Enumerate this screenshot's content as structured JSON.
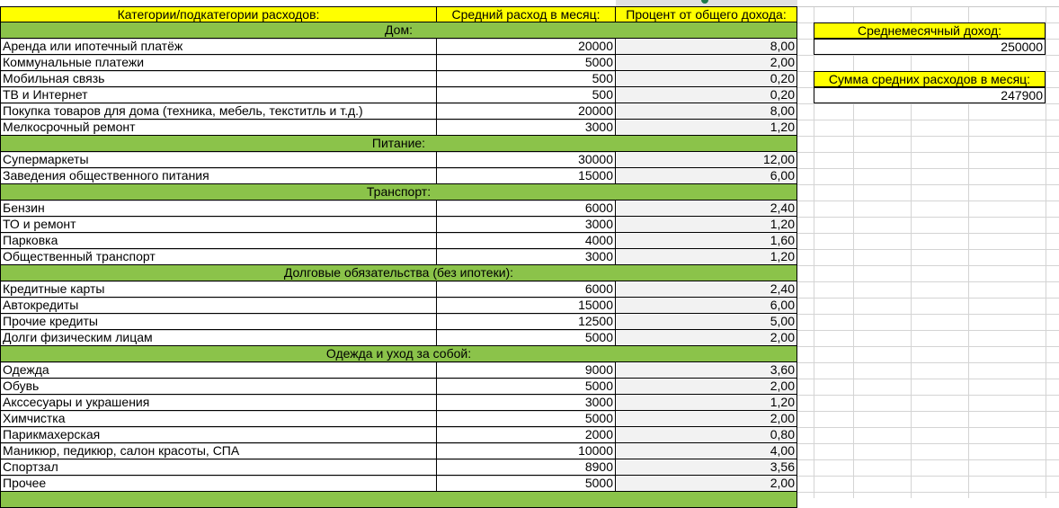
{
  "header": {
    "col1": "Категории/подкатегории расходов:",
    "col2": "Средний расход в месяц:",
    "col3": "Процент от общего дохода:"
  },
  "sections": [
    {
      "title": "Дом:",
      "items": [
        {
          "name": "Аренда или ипотечный платёж",
          "amount": "20000",
          "percent": "8,00"
        },
        {
          "name": "Коммунальные платежи",
          "amount": "5000",
          "percent": "2,00"
        },
        {
          "name": "Мобильная связь",
          "amount": "500",
          "percent": "0,20"
        },
        {
          "name": "ТВ и Интернет",
          "amount": "500",
          "percent": "0,20"
        },
        {
          "name": "Покупка товаров для дома (техника, мебель, текститль и т.д.)",
          "amount": "20000",
          "percent": "8,00"
        },
        {
          "name": "Мелкосрочный ремонт",
          "amount": "3000",
          "percent": "1,20"
        }
      ]
    },
    {
      "title": "Питание:",
      "items": [
        {
          "name": "Супермаркеты",
          "amount": "30000",
          "percent": "12,00"
        },
        {
          "name": "Заведения общественного питания",
          "amount": "15000",
          "percent": "6,00"
        }
      ]
    },
    {
      "title": "Транспорт:",
      "items": [
        {
          "name": "Бензин",
          "amount": "6000",
          "percent": "2,40"
        },
        {
          "name": "ТО и ремонт",
          "amount": "3000",
          "percent": "1,20"
        },
        {
          "name": "Парковка",
          "amount": "4000",
          "percent": "1,60"
        },
        {
          "name": "Общественный транспорт",
          "amount": "3000",
          "percent": "1,20"
        }
      ]
    },
    {
      "title": "Долговые обязательства (без ипотеки):",
      "items": [
        {
          "name": "Кредитные карты",
          "amount": "6000",
          "percent": "2,40"
        },
        {
          "name": "Автокредиты",
          "amount": "15000",
          "percent": "6,00"
        },
        {
          "name": "Прочие кредиты",
          "amount": "12500",
          "percent": "5,00"
        },
        {
          "name": "Долги физическим лицам",
          "amount": "5000",
          "percent": "2,00"
        }
      ]
    },
    {
      "title": "Одежда и уход за собой:",
      "items": [
        {
          "name": "Одежда",
          "amount": "9000",
          "percent": "3,60"
        },
        {
          "name": "Обувь",
          "amount": "5000",
          "percent": "2,00"
        },
        {
          "name": "Акссесуары и украшения",
          "amount": "3000",
          "percent": "1,20"
        },
        {
          "name": "Химчистка",
          "amount": "5000",
          "percent": "2,00"
        },
        {
          "name": "Парикмахерская",
          "amount": "2000",
          "percent": "0,80"
        },
        {
          "name": "Маникюр, педикюр, салон красоты, СПА",
          "amount": "10000",
          "percent": "4,00"
        },
        {
          "name": "Спортзал",
          "amount": "8900",
          "percent": "3,56"
        },
        {
          "name": "Прочее",
          "amount": "5000",
          "percent": "2,00"
        }
      ]
    }
  ],
  "summary": {
    "income_label": "Среднемесячный доход:",
    "income_value": "250000",
    "expenses_label": "Сумма средних расходов в месяц:",
    "expenses_value": "247900"
  },
  "colors": {
    "header": "#ffff00",
    "section": "#8bc34a",
    "percent_column": "#f2f2f2"
  }
}
